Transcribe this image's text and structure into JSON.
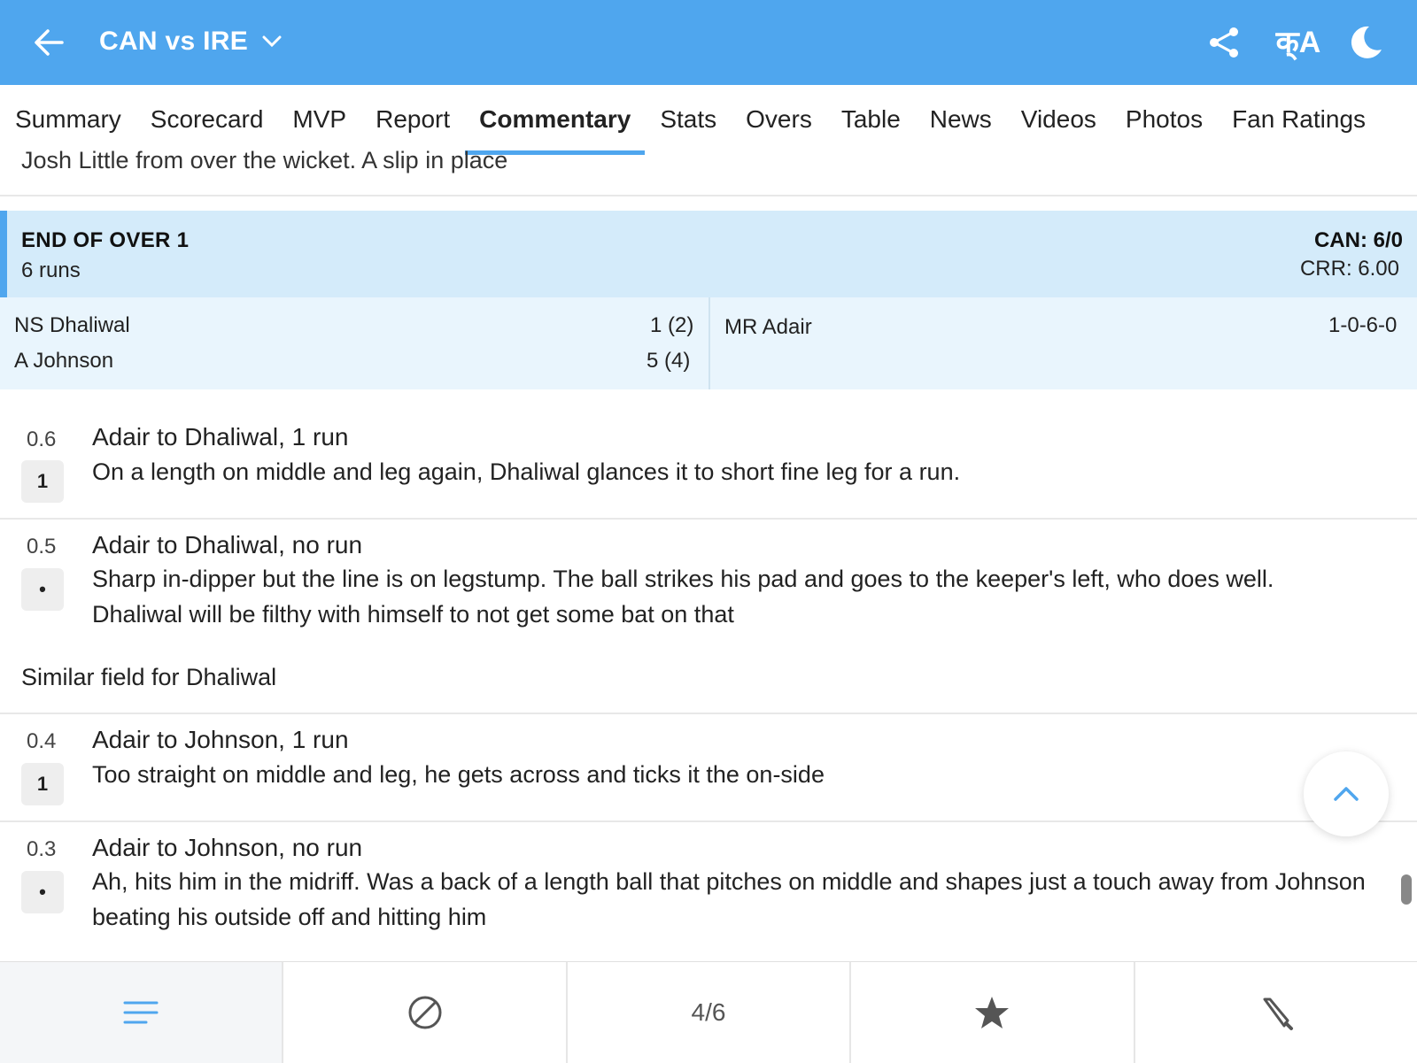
{
  "header": {
    "title": "CAN vs IRE",
    "lang_glyph": "क्A"
  },
  "tabs": [
    "Summary",
    "Scorecard",
    "MVP",
    "Report",
    "Commentary",
    "Stats",
    "Overs",
    "Table",
    "News",
    "Videos",
    "Photos",
    "Fan Ratings"
  ],
  "active_tab": "Commentary",
  "top_line": "Josh Little from over the wicket. A slip in place",
  "end_of_over": {
    "heading": "END OF OVER 1",
    "runs": "6 runs",
    "score": "CAN: 6/0",
    "crr": "CRR: 6.00"
  },
  "batters": [
    {
      "name": "NS Dhaliwal",
      "score": "1 (2)"
    },
    {
      "name": "A Johnson",
      "score": "5 (4)"
    }
  ],
  "bowler": {
    "name": "MR Adair",
    "figures": "1-0-6-0"
  },
  "commentary": [
    {
      "over": "0.6",
      "result": "1",
      "title": "Adair to Dhaliwal, 1 run",
      "text": "On a length on middle and leg again, Dhaliwal glances it to short fine leg for a run."
    },
    {
      "over": "0.5",
      "result": "•",
      "title": "Adair to Dhaliwal, no run",
      "text": "Sharp in-dipper but the line is on legstump. The ball strikes his pad and goes to the keeper's left, who does well. Dhaliwal will be filthy with himself to not get some bat on that"
    },
    {
      "over": "0.4",
      "result": "1",
      "title": "Adair to Johnson, 1 run",
      "text": "Too straight on middle and leg, he gets across and ticks it the on-side"
    },
    {
      "over": "0.3",
      "result": "•",
      "title": "Adair to Johnson, no run",
      "text": "Ah, hits him in the midriff. Was a back of a length ball that pitches on middle and shapes just a touch away from Johnson beating his outside off and hitting him"
    }
  ],
  "field_note": "Similar field for Dhaliwal",
  "bottom_nav": {
    "count": "4/6"
  },
  "colors": {
    "accent": "#4fa6ee",
    "over_bg": "#d4ebfa",
    "players_bg": "#e9f5fd"
  }
}
